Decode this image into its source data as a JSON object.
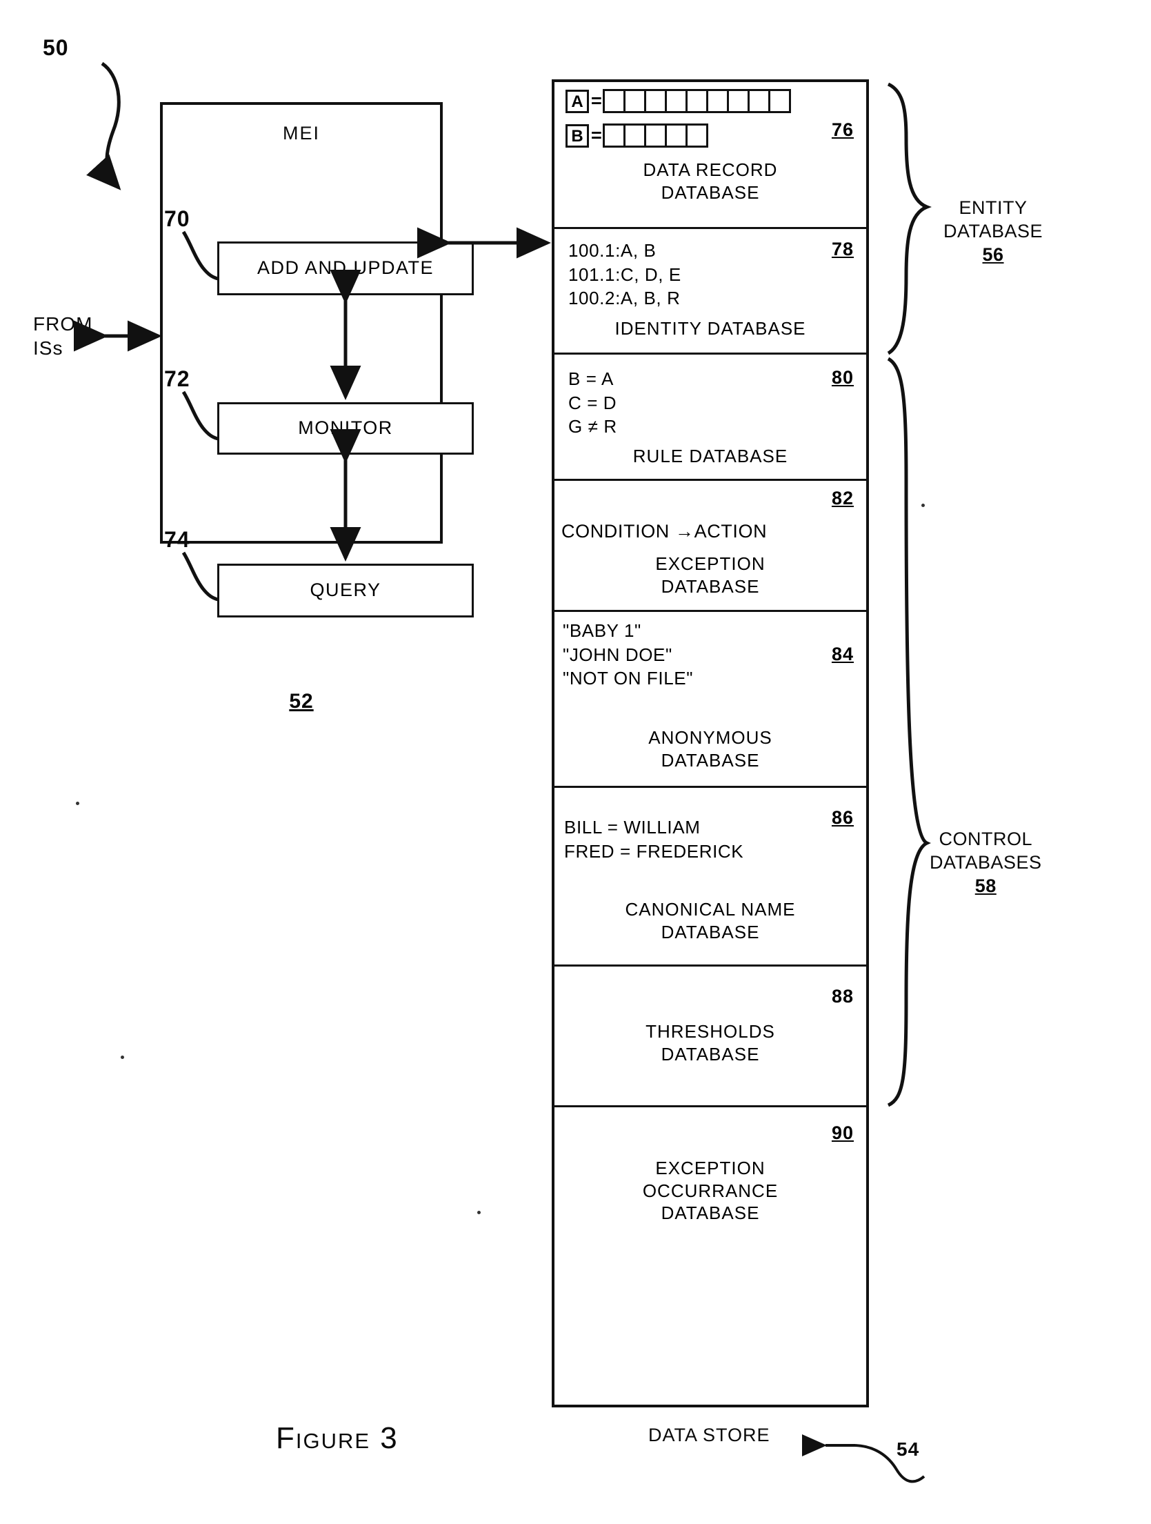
{
  "figure": {
    "caption": "Figure 3",
    "top_ref": "50",
    "from_label_line1": "FROM",
    "from_label_line2": "ISs",
    "data_store_label": "DATA STORE",
    "data_store_ref": "54"
  },
  "mei": {
    "title": "MEI",
    "ref": "52",
    "modules": [
      {
        "label": "ADD AND UPDATE",
        "ref": "70"
      },
      {
        "label": "MONITOR",
        "ref": "72"
      },
      {
        "label": "QUERY",
        "ref": "74"
      }
    ]
  },
  "braces": {
    "entity": {
      "line1": "ENTITY",
      "line2": "DATABASE",
      "ref": "56"
    },
    "control": {
      "line1": "CONTROL",
      "line2": "DATABASES",
      "ref": "58"
    }
  },
  "databases": [
    {
      "ref": "76",
      "title_line1": "DATA RECORD",
      "title_line2": "DATABASE",
      "records": [
        {
          "key": "A",
          "eq": "=",
          "cells": 9
        },
        {
          "key": "B",
          "eq": "=",
          "cells": 5
        }
      ]
    },
    {
      "ref": "78",
      "lines": [
        "100.1:A, B",
        "101.1:C, D, E",
        "100.2:A, B, R"
      ],
      "title_line1": "IDENTITY DATABASE",
      "title_line2": ""
    },
    {
      "ref": "80",
      "lines": [
        "B = A",
        "C = D",
        "G ≠ R"
      ],
      "title_line1": "RULE  DATABASE",
      "title_line2": ""
    },
    {
      "ref": "82",
      "lines": [
        "CONDITION →ACTION"
      ],
      "title_line1": "EXCEPTION",
      "title_line2": "DATABASE"
    },
    {
      "ref": "84",
      "lines": [
        "\"BABY 1\"",
        "\"JOHN DOE\"",
        "\"NOT ON FILE\""
      ],
      "title_line1": "ANONYMOUS",
      "title_line2": "DATABASE"
    },
    {
      "ref": "86",
      "lines": [
        "BILL = WILLIAM",
        "FRED = FREDERICK"
      ],
      "title_line1": "CANONICAL NAME",
      "title_line2": "DATABASE"
    },
    {
      "ref": "88",
      "lines": [],
      "title_line1": "THRESHOLDS",
      "title_line2": "DATABASE"
    },
    {
      "ref": "90",
      "lines": [],
      "title_line1": "EXCEPTION",
      "title_line2": "OCCURRANCE",
      "title_line3": "DATABASE"
    }
  ]
}
